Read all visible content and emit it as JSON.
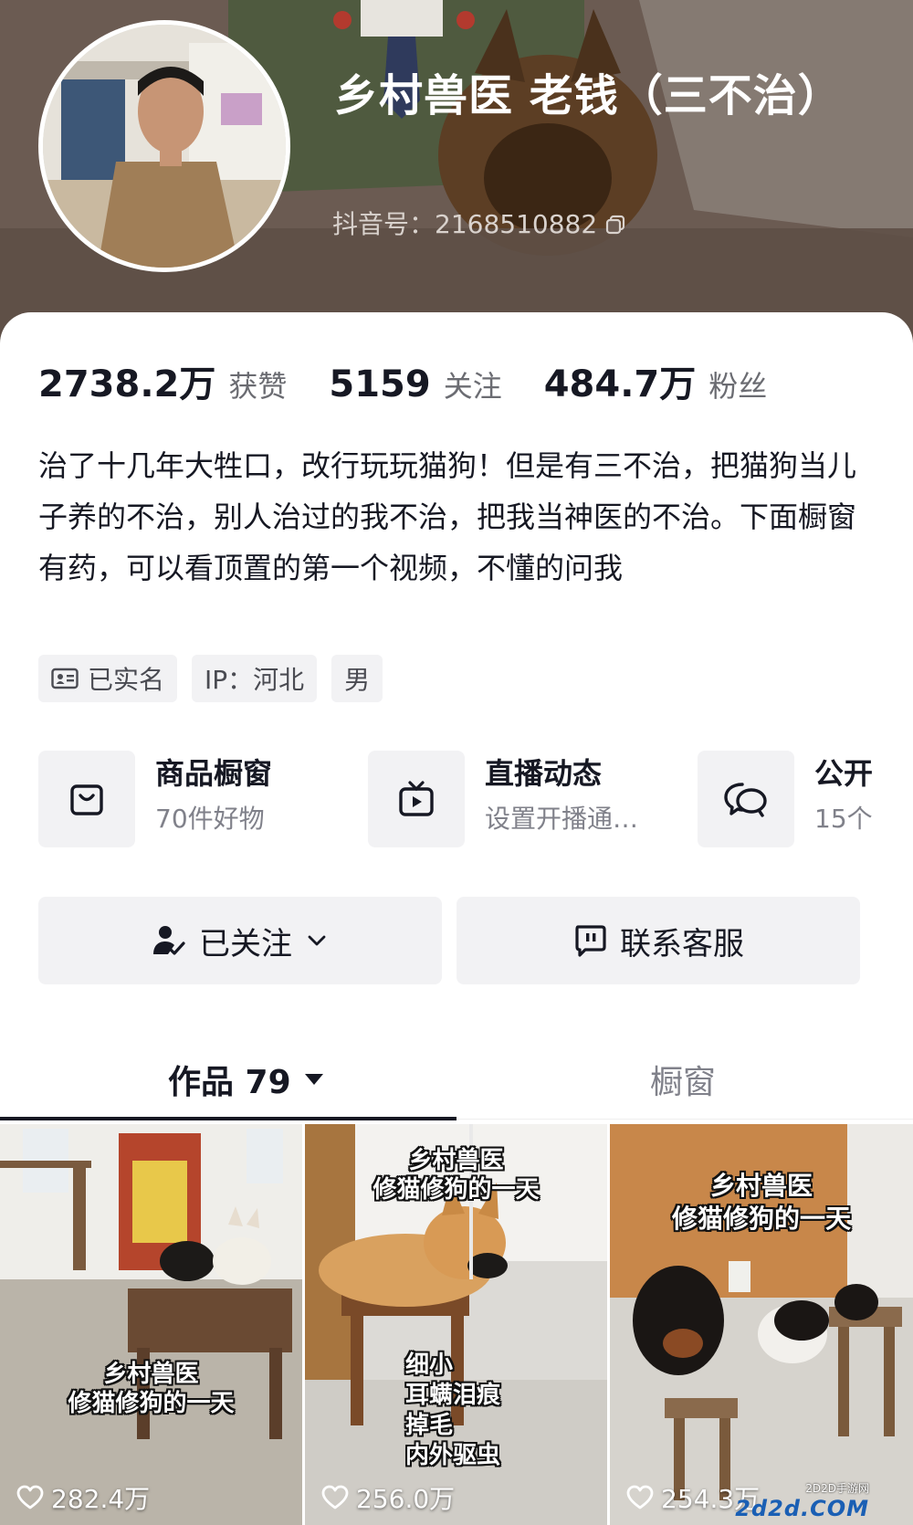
{
  "profile": {
    "display_name": "乡村兽医  老钱（三不治）",
    "douyin_id": "抖音号：2168510882"
  },
  "stats": [
    {
      "value": "2738.2万",
      "label": "获赞"
    },
    {
      "value": "5159",
      "label": "关注"
    },
    {
      "value": "484.7万",
      "label": "粉丝"
    }
  ],
  "bio": "治了十几年大牲口，改行玩玩猫狗！但是有三不治，把猫狗当儿子养的不治，别人治过的我不治，把我当神医的不治。下面橱窗有药，可以看顶置的第一个视频，不懂的问我",
  "tags": {
    "verified": "已实名",
    "ip": "IP：河北",
    "gender": "男"
  },
  "features": [
    {
      "title": "商品橱窗",
      "subtitle": "70件好物",
      "icon": "shopping-bag-icon"
    },
    {
      "title": "直播动态",
      "subtitle": "设置开播通…",
      "icon": "tv-icon"
    },
    {
      "title": "公开",
      "subtitle": "15个",
      "icon": "chat-bubbles-icon"
    }
  ],
  "actions": {
    "follow_label": "已关注",
    "service_label": "联系客服"
  },
  "tabs": {
    "works_label": "作品 79",
    "showcase_label": "橱窗"
  },
  "videos": [
    {
      "caption_line1": "乡村兽医",
      "caption_line2": "修猫修狗的一天",
      "likes": "282.4万"
    },
    {
      "caption_line1": "乡村兽医",
      "caption_line2": "修猫修狗的一天",
      "extra_lines": [
        "细小",
        "耳螨泪痕",
        "掉毛",
        "内外驱虫"
      ],
      "likes": "256.0万"
    },
    {
      "caption_line1": "乡村兽医",
      "caption_line2": "修猫修狗的一天",
      "likes": "254.3万"
    }
  ],
  "watermark": {
    "small": "2D2D手游网",
    "main": "2d2d.COM"
  },
  "colors": {
    "text_primary": "#161823",
    "text_secondary": "#6b6c72",
    "chip_background": "#f2f2f4",
    "header_background": "#6d5d54"
  }
}
